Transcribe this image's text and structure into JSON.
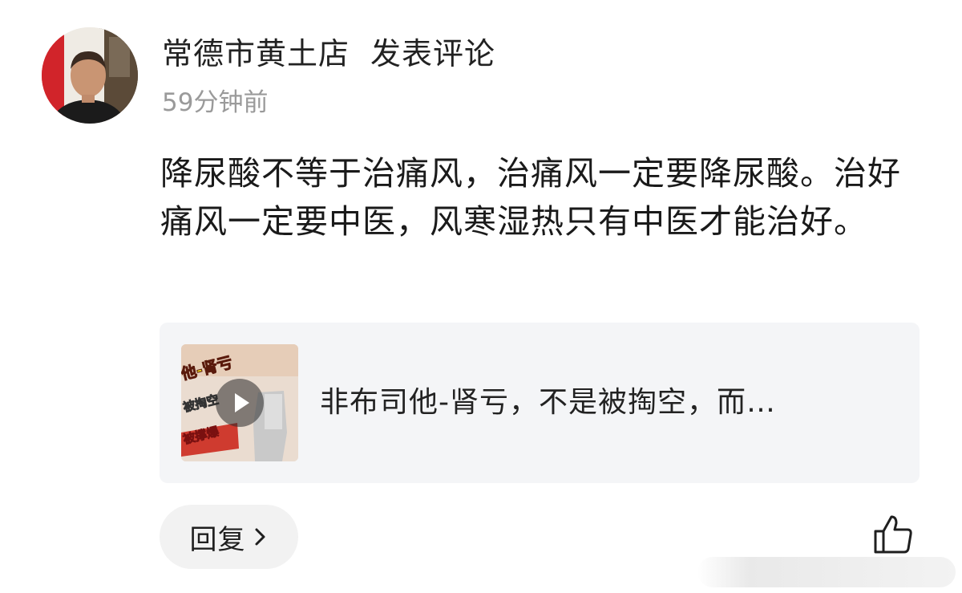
{
  "comment": {
    "author": "常德市黄土店",
    "action": "发表评论",
    "timestamp": "59分钟前",
    "text": "降尿酸不等于治痛风，治痛风一定要降尿酸。治好痛风一定要中医，风寒湿热只有中医才能治好。"
  },
  "link_card": {
    "title": "非布司他-肾亏，不是被掏空，而…",
    "thumbnail_text": [
      "他-肾亏",
      "被掏空",
      "被撑爆"
    ],
    "thumbnail_icon": "play-icon"
  },
  "actions": {
    "reply_label": "回复",
    "reply_icon": "chevron-right-icon",
    "like_icon": "thumbs-up-icon"
  },
  "colors": {
    "text_primary": "#1a1a1a",
    "text_secondary": "#9a9a9a",
    "card_background": "#f4f5f7",
    "reply_background": "#f2f2f2"
  }
}
